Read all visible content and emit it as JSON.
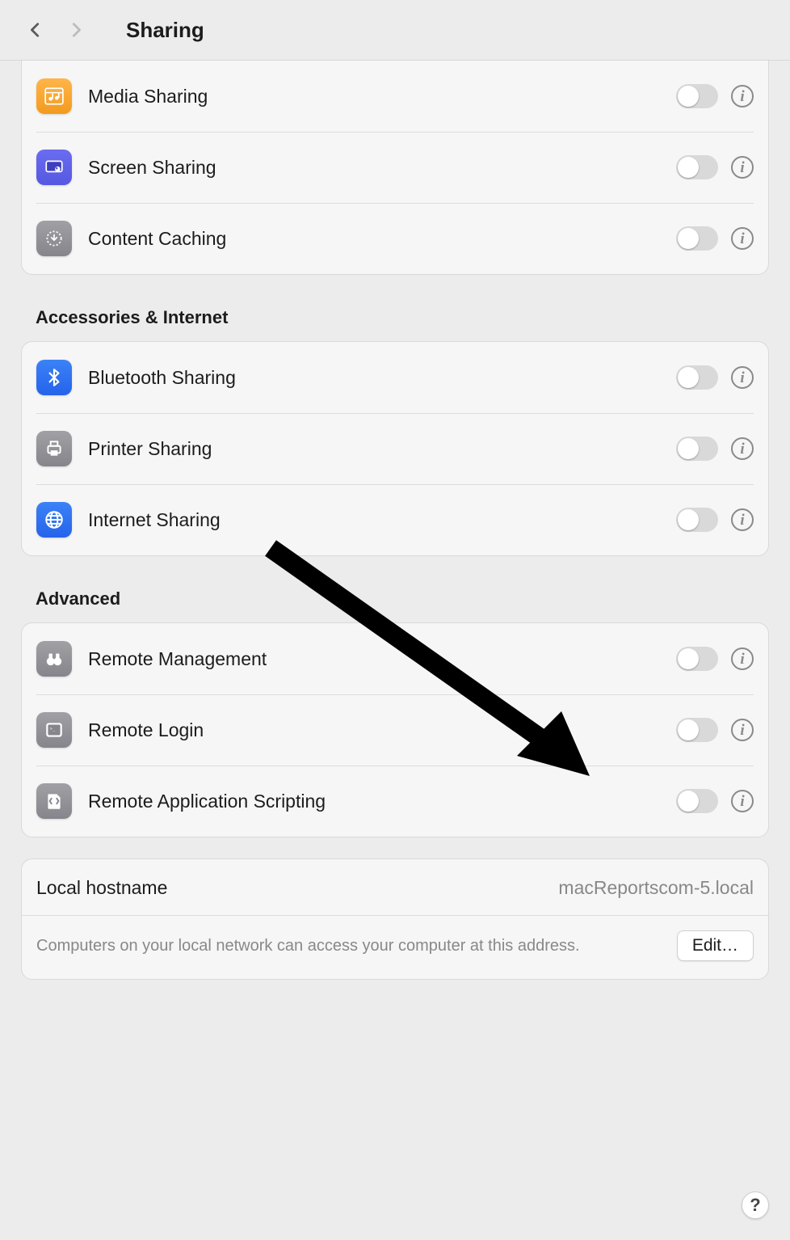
{
  "header": {
    "title": "Sharing"
  },
  "sections": {
    "top_items": [
      {
        "label": "Media Sharing",
        "icon": "media-sharing-icon",
        "enabled": false
      },
      {
        "label": "Screen Sharing",
        "icon": "screen-sharing-icon",
        "enabled": false
      },
      {
        "label": "Content Caching",
        "icon": "content-caching-icon",
        "enabled": false
      }
    ],
    "accessories_heading": "Accessories & Internet",
    "accessories_items": [
      {
        "label": "Bluetooth Sharing",
        "icon": "bluetooth-icon",
        "enabled": false
      },
      {
        "label": "Printer Sharing",
        "icon": "printer-icon",
        "enabled": false
      },
      {
        "label": "Internet Sharing",
        "icon": "globe-icon",
        "enabled": false
      }
    ],
    "advanced_heading": "Advanced",
    "advanced_items": [
      {
        "label": "Remote Management",
        "icon": "binoculars-icon",
        "enabled": false
      },
      {
        "label": "Remote Login",
        "icon": "terminal-icon",
        "enabled": false
      },
      {
        "label": "Remote Application Scripting",
        "icon": "script-icon",
        "enabled": false
      }
    ]
  },
  "hostname": {
    "label": "Local hostname",
    "value": "macReportscom-5.local",
    "description": "Computers on your local network can access your computer at this address.",
    "edit_label": "Edit…"
  },
  "help_label": "?"
}
